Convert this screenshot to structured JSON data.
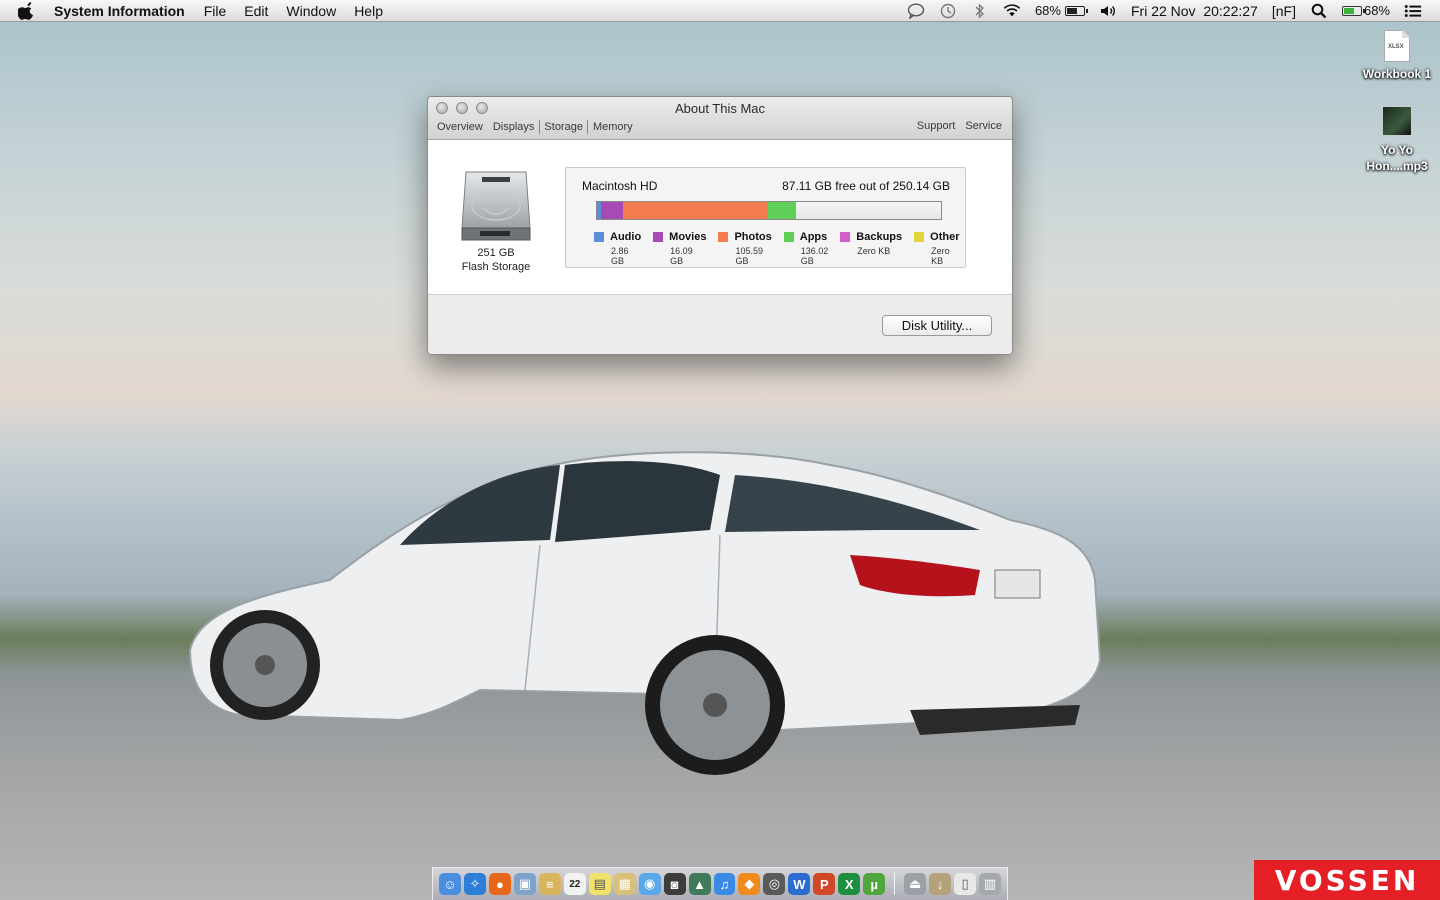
{
  "menubar": {
    "app_name": "System Information",
    "items": [
      "File",
      "Edit",
      "Window",
      "Help"
    ],
    "battery_percent_1": "68%",
    "datetime": "Fri 22 Nov  20:22:27",
    "input_source": "[nF]",
    "battery_percent_2": "68%",
    "battery_level": 0.68
  },
  "desktop": {
    "icons": [
      {
        "label": "Workbook 1",
        "thumb": "XLSX"
      },
      {
        "label": "Yo Yo Hon....mp3"
      }
    ]
  },
  "window": {
    "title": "About This Mac",
    "tabs": [
      "Overview",
      "Displays",
      "Storage",
      "Memory"
    ],
    "active_tab": "Storage",
    "right_links": [
      "Support",
      "Service"
    ],
    "drive": {
      "size": "251 GB",
      "type": "Flash Storage"
    },
    "volume": {
      "name": "Macintosh HD",
      "free_text": "87.11 GB free out of 250.14 GB"
    },
    "categories": [
      {
        "name": "Audio",
        "size": "2.86 GB",
        "gb": 2.86,
        "color": "#5a8fd8"
      },
      {
        "name": "Movies",
        "size": "16.09 GB",
        "gb": 16.09,
        "color": "#a64ab5"
      },
      {
        "name": "Photos",
        "size": "105.59 GB",
        "gb": 105.59,
        "color": "#f47b50"
      },
      {
        "name": "Apps",
        "size": "136.02 GB",
        "gb": 20.5,
        "color": "#5fcf5a"
      },
      {
        "name": "Backups",
        "size": "Zero KB",
        "gb": 0,
        "color": "#d35ec9"
      },
      {
        "name": "Other",
        "size": "Zero KB",
        "gb": 0,
        "color": "#e2d43a"
      }
    ],
    "total_gb": 250.14,
    "disk_utility_label": "Disk Utility..."
  },
  "dock": {
    "icons": [
      "finder-icon",
      "safari-icon",
      "firefox-icon",
      "preview-icon",
      "notes-icon",
      "calendar-icon",
      "stickies-icon",
      "photos-icon",
      "messages-icon",
      "facetime-icon",
      "iphoto-icon",
      "itunes-icon",
      "vlc-icon",
      "activity-icon",
      "word-icon",
      "powerpoint-icon",
      "excel-icon",
      "utorrent-icon",
      "usb-icon",
      "downloads-icon",
      "documents-icon",
      "trash-icon"
    ],
    "calendar_day": "22"
  },
  "brand": "VOSSEN"
}
